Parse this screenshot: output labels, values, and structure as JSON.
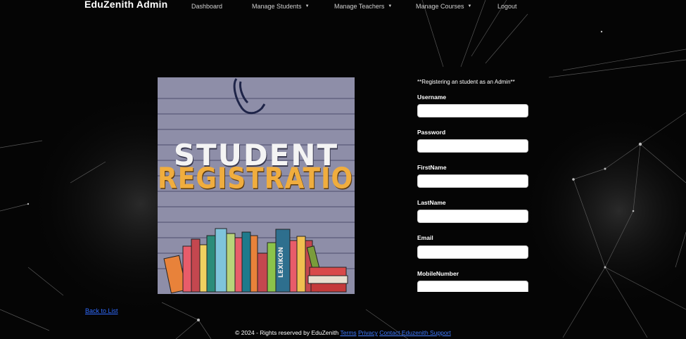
{
  "nav": {
    "brand": "EduZenith Admin",
    "items": [
      {
        "label": "Dashboard",
        "dropdown": false
      },
      {
        "label": "Manage Students",
        "dropdown": true
      },
      {
        "label": "Manage Teachers",
        "dropdown": true
      },
      {
        "label": "Manage Courses",
        "dropdown": true
      },
      {
        "label": "Logout",
        "dropdown": false
      }
    ],
    "caret": "▼"
  },
  "poster": {
    "line1": "STUDENT",
    "line2": "REGISTRATION",
    "book_spine_text": "LEXIKON",
    "colors": {
      "background": "#8e8ea8",
      "title_top": "#f4f4f4",
      "title_bottom": "#f0ad3e"
    }
  },
  "form": {
    "note": "**Registering an student as an Admin**",
    "fields": [
      {
        "label": "Username",
        "value": ""
      },
      {
        "label": "Password",
        "value": ""
      },
      {
        "label": "FirstName",
        "value": ""
      },
      {
        "label": "LastName",
        "value": ""
      },
      {
        "label": "Email",
        "value": ""
      },
      {
        "label": "MobileNumber",
        "value": ""
      }
    ]
  },
  "back_link": "Back to List",
  "footer": {
    "text": "© 2024 - Rights reserved by EduZenith",
    "links": [
      "Terms",
      "Privacy",
      "Contact Eduzenith Support"
    ]
  },
  "colors": {
    "background": "#050505",
    "link": "#2f6bff"
  }
}
